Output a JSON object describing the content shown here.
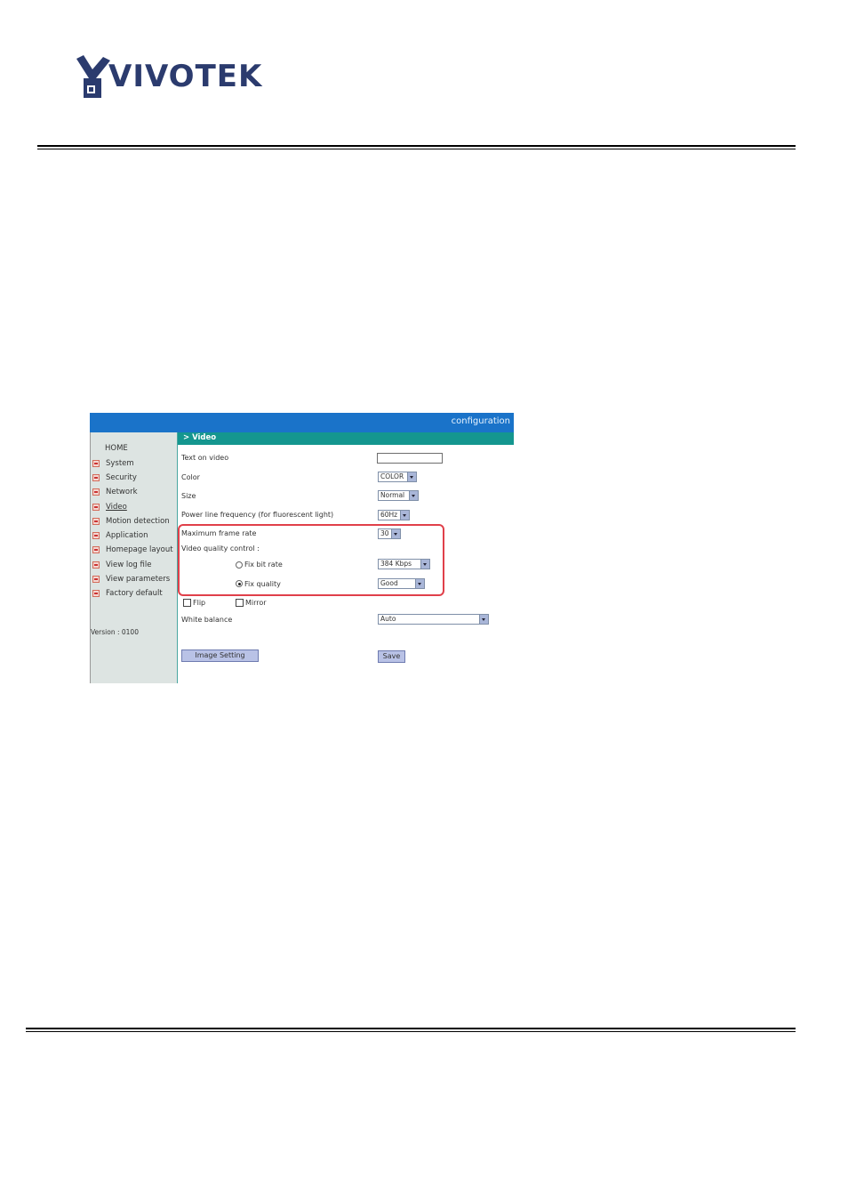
{
  "logo": {
    "text": "VIVOTEK"
  },
  "header": {
    "config_label": "configuration"
  },
  "section": {
    "title": "> Video"
  },
  "sidebar": {
    "home": "HOME",
    "items": [
      {
        "label": "System"
      },
      {
        "label": "Security"
      },
      {
        "label": "Network"
      },
      {
        "label": "Video"
      },
      {
        "label": "Motion detection"
      },
      {
        "label": "Application"
      },
      {
        "label": "Homepage layout"
      },
      {
        "label": "View log file"
      },
      {
        "label": "View parameters"
      },
      {
        "label": "Factory default"
      }
    ],
    "version": "Version : 0100"
  },
  "form": {
    "text_on_video": {
      "label": "Text on video",
      "value": ""
    },
    "color": {
      "label": "Color",
      "value": "COLOR"
    },
    "size": {
      "label": "Size",
      "value": "Normal"
    },
    "power_line": {
      "label": "Power line frequency (for fluorescent light)",
      "value": "60Hz"
    },
    "max_frame_rate": {
      "label": "Maximum frame rate",
      "value": "30"
    },
    "video_quality_control": {
      "label": "Video quality control :"
    },
    "fix_bit_rate": {
      "label": "Fix bit rate",
      "value": "384 Kbps"
    },
    "fix_quality": {
      "label": "Fix quality",
      "value": "Good"
    },
    "flip": {
      "label": "Flip"
    },
    "mirror": {
      "label": "Mirror"
    },
    "white_balance": {
      "label": "White balance",
      "value": "Auto"
    },
    "image_setting_button": "Image Setting",
    "save_button": "Save"
  },
  "colors": {
    "topbar": "#1a73c9",
    "section_bar": "#14968f",
    "sidebar_bg": "#dde4e2",
    "highlight": "#e0404a"
  }
}
